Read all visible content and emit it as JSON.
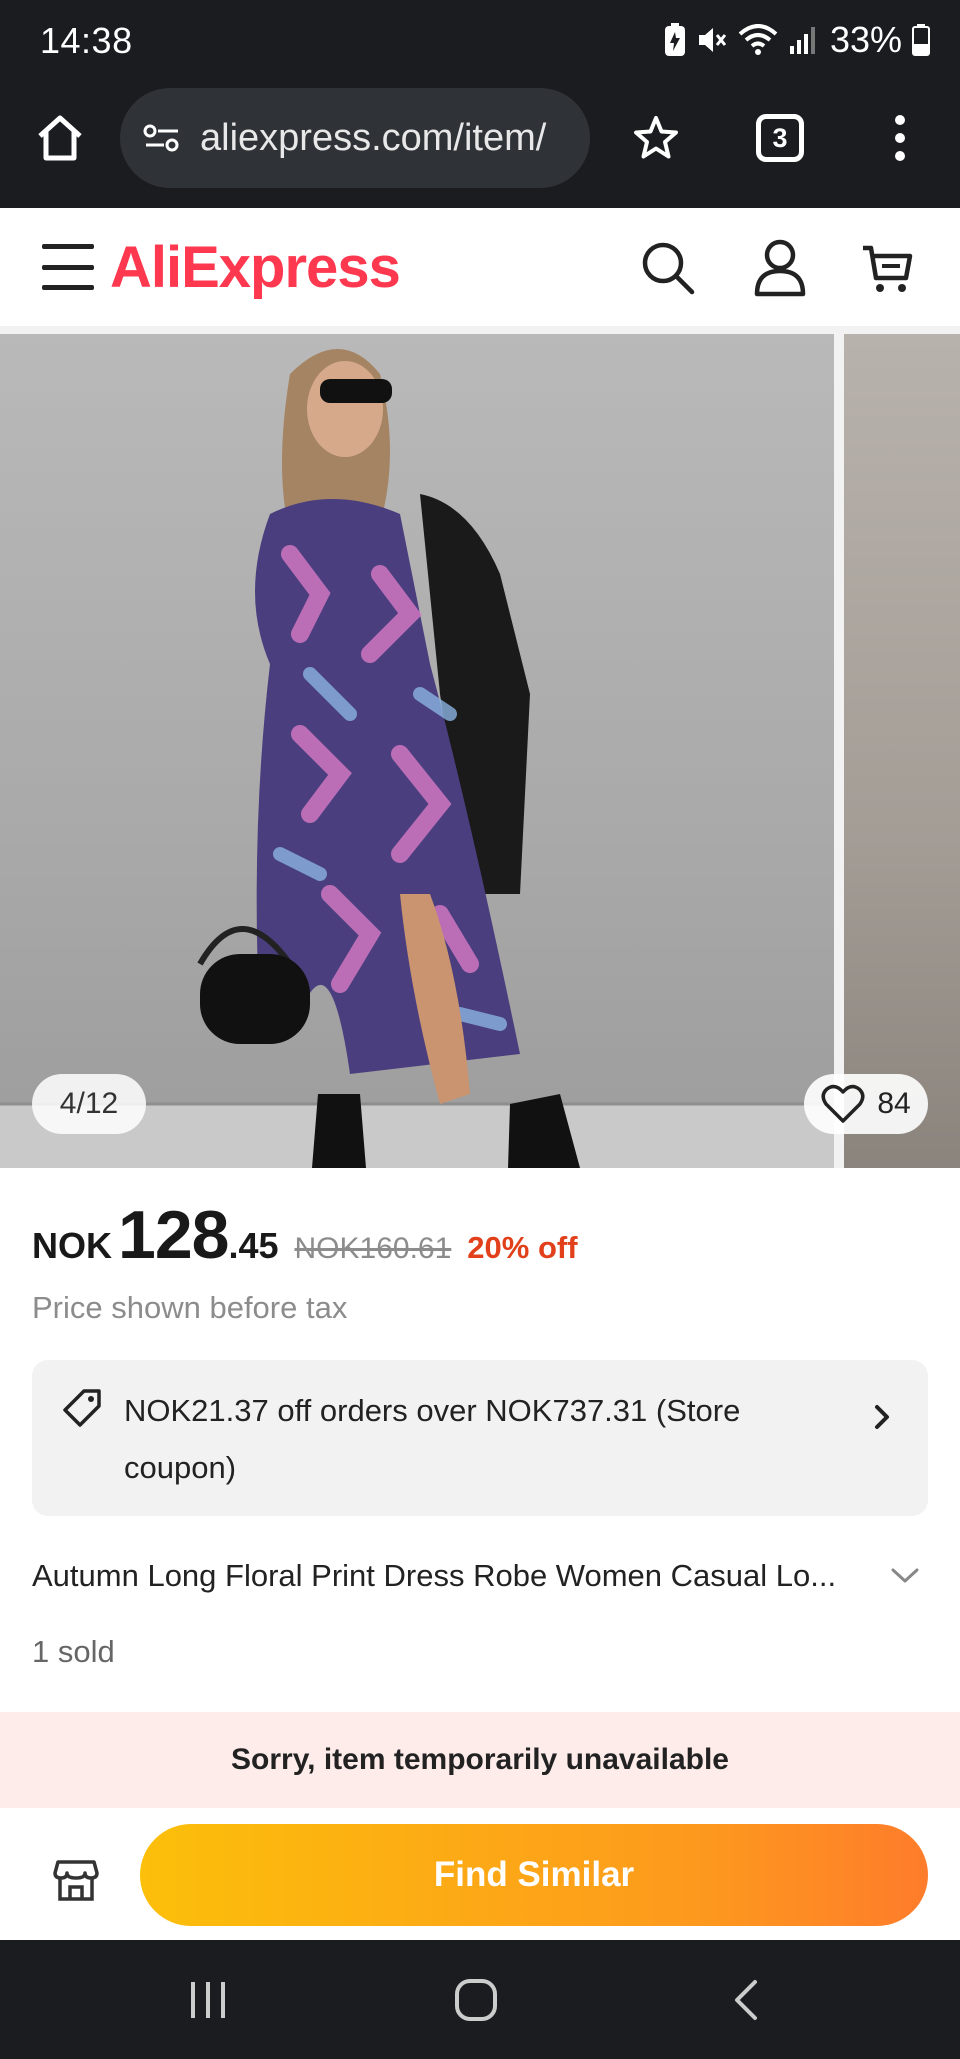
{
  "status_bar": {
    "time": "14:38",
    "battery": "33%",
    "icons": [
      "battery-saver-icon",
      "mute-icon",
      "wifi-icon",
      "signal-icon",
      "battery-icon"
    ]
  },
  "browser": {
    "url": "aliexpress.com/item/",
    "tab_count": "3",
    "icons": [
      "home-icon",
      "site-settings-icon",
      "bookmark-star-icon",
      "tabs-icon",
      "more-vert-icon"
    ]
  },
  "site_header": {
    "logo": "AliExpress",
    "icons": [
      "menu-icon",
      "search-icon",
      "account-icon",
      "cart-icon"
    ],
    "brand_color": "#fd384f"
  },
  "gallery": {
    "counter": "4/12",
    "wishlist_count": "84"
  },
  "price": {
    "currency": "NOK",
    "integer": "128",
    "decimal": ".45",
    "original": "NOK160.61",
    "discount": "20% off",
    "tax_note": "Price shown before tax",
    "discount_color": "#e1401b"
  },
  "coupon": {
    "text": "NOK21.37 off orders over NOK737.31 (Store coupon)"
  },
  "product": {
    "title": "Autumn Long Floral Print Dress Robe Women Casual Lo...",
    "sold": "1 sold"
  },
  "notice": {
    "unavailable": "Sorry, item temporarily unavailable"
  },
  "actions": {
    "find_similar": "Find Similar"
  }
}
